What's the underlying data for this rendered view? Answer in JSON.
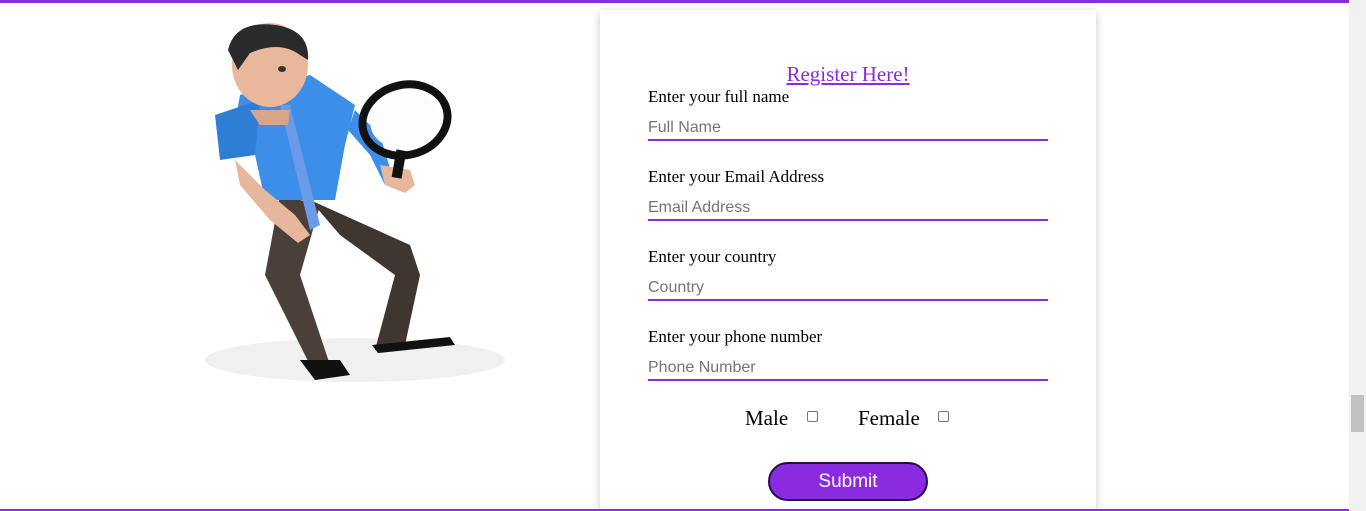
{
  "form": {
    "title_link": "Register Here!",
    "fields": [
      {
        "label": "Enter your full name",
        "placeholder": "Full Name",
        "value": ""
      },
      {
        "label": "Enter your Email Address",
        "placeholder": "Email Address",
        "value": ""
      },
      {
        "label": "Enter your country",
        "placeholder": "Country",
        "value": ""
      },
      {
        "label": "Enter your phone number",
        "placeholder": "Phone Number",
        "value": ""
      }
    ],
    "gender": {
      "male_label": "Male",
      "female_label": "Female",
      "male_checked": false,
      "female_checked": false
    },
    "submit_label": "Submit"
  },
  "illustration": {
    "icon": "man-with-magnifying-glass"
  },
  "colors": {
    "accent": "#8a2be2",
    "button_border": "#2a0a45",
    "text": "#000000",
    "placeholder": "#757575"
  }
}
